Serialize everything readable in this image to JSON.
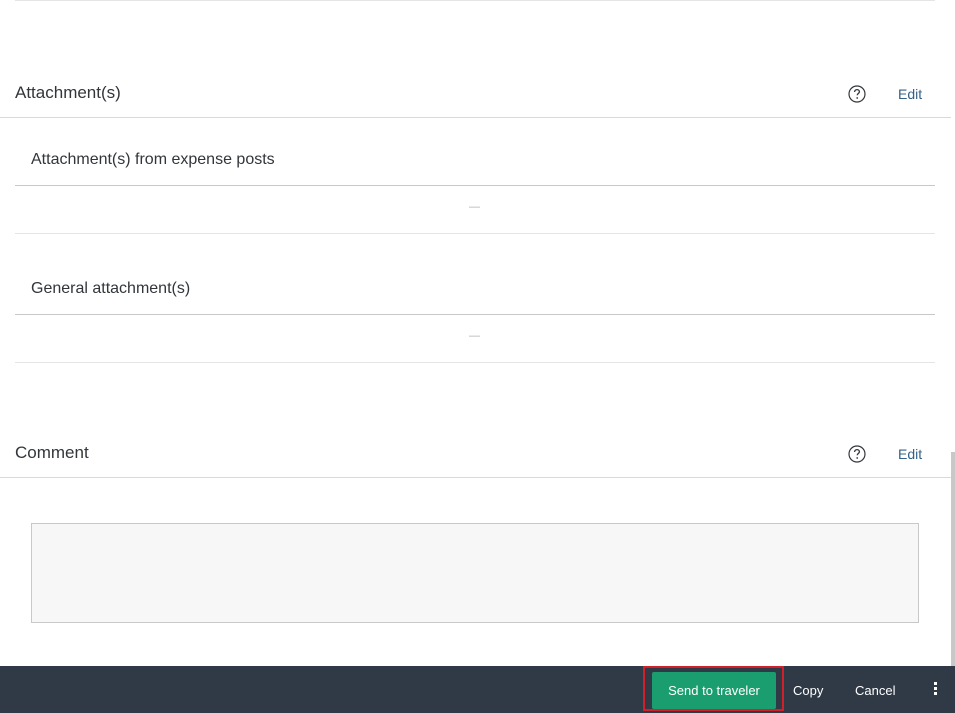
{
  "attachments_section": {
    "title": "Attachment(s)",
    "help_icon": "help-circle-icon",
    "edit_label": "Edit",
    "expense_posts": {
      "title": "Attachment(s) from expense posts",
      "empty_value": "—"
    },
    "general": {
      "title": "General attachment(s)",
      "empty_value": "—"
    }
  },
  "comment_section": {
    "title": "Comment",
    "help_icon": "help-circle-icon",
    "edit_label": "Edit",
    "value": ""
  },
  "footer": {
    "send_label": "Send to traveler",
    "copy_label": "Copy",
    "cancel_label": "Cancel",
    "more_icon": "vertical-dots-icon"
  },
  "colors": {
    "footer_bg": "#2f3a46",
    "send_button": "#1b9e6f",
    "highlight": "#d0202a",
    "link": "#346187"
  }
}
